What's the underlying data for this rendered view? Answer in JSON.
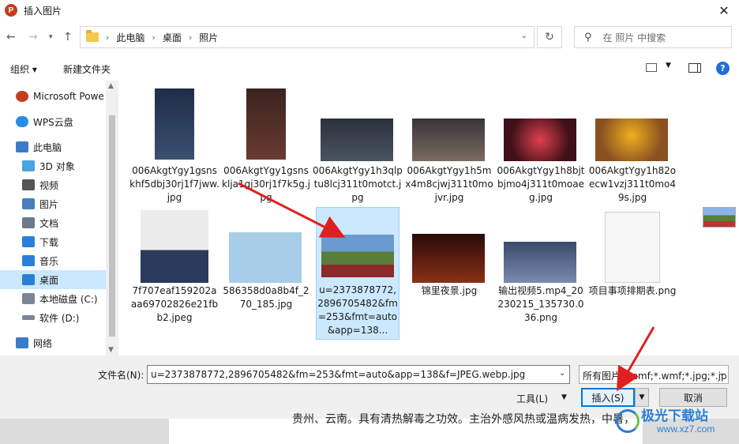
{
  "window": {
    "title": "插入图片",
    "app_icon_letter": "P"
  },
  "nav": {
    "breadcrumb": [
      "此电脑",
      "桌面",
      "照片"
    ],
    "search_placeholder": "在 照片 中搜索"
  },
  "toolbar": {
    "organize": "组织 ▾",
    "new_folder": "新建文件夹"
  },
  "sidebar": {
    "items": [
      {
        "label": "Microsoft Powe",
        "color": "#c43e1c"
      },
      {
        "label": "WPS云盘",
        "color": "#2a8be8"
      },
      {
        "label": "此电脑",
        "color": "#3a7cc9"
      },
      {
        "label": "3D 对象",
        "color": "#49a4e0"
      },
      {
        "label": "视频",
        "color": "#555"
      },
      {
        "label": "图片",
        "color": "#4a7eb8"
      },
      {
        "label": "文档",
        "color": "#6c7a8a"
      },
      {
        "label": "下载",
        "color": "#2c7fd8"
      },
      {
        "label": "音乐",
        "color": "#2c7fd8"
      },
      {
        "label": "桌面",
        "color": "#2a7fd4"
      },
      {
        "label": "本地磁盘 (C:)",
        "color": "#7a8796"
      },
      {
        "label": "软件 (D:)",
        "color": "#7a8796"
      },
      {
        "label": "网络",
        "color": "#3a7cc9"
      }
    ]
  },
  "files": [
    {
      "name": "006AkgtYgy1gsnskhf5dbj30rj1f7jww.jpg",
      "color": "#2a3b55"
    },
    {
      "name": "006AkgtYgy1gsnsklja1gj30rj1f7k5g.jpg",
      "color": "#4a2a28"
    },
    {
      "name": "006AkgtYgy1h3qlptu8lcj311t0motct.jpg",
      "color": "#3a4450"
    },
    {
      "name": "006AkgtYgy1h5mx4m8cjwj311t0mojvr.jpg",
      "color": "#5a4a48"
    },
    {
      "name": "006AkgtYgy1h8bjtbjmo4j311t0moaeg.jpg",
      "color": "#7a1a22"
    },
    {
      "name": "006AkgtYgy1h82oecw1vzj311t0mo49s.jpg",
      "color": "#c08a2a"
    },
    {
      "name": "7f707eaf159202aaa69702826e21fbb2.jpeg",
      "color": "#d8d8d8"
    },
    {
      "name": "586358d0a8b4f_270_185.jpg",
      "color": "#a8cde6"
    },
    {
      "name": "u=2373878772,2896705482&fm=253&fmt=auto&app=138...",
      "color": "#6a9ad0"
    },
    {
      "name": "锦里夜景.jpg",
      "color": "#5a2018"
    },
    {
      "name": "输出视频5.mp4_20230215_135730.036.png",
      "color": "#4a5a78"
    },
    {
      "name": "项目事项排期表.png",
      "color": "#f4f4f4"
    }
  ],
  "bottom": {
    "filename_label": "文件名(N):",
    "filename_value": "u=2373878772,2896705482&fm=253&fmt=auto&app=138&f=JPEG.webp.jpg",
    "filetype_value": "所有图片(*.emf;*.wmf;*.jpg;*.jp",
    "tools_label": "工具(L)",
    "insert_label": "插入(S)",
    "cancel_label": "取消"
  },
  "background_doc": {
    "line1": "贵州、云南。具有清热解毒之功效。主治外感风热或温病发热，中暑，"
  },
  "watermark": {
    "title": "极光下载站",
    "url": "www.xz7.com"
  }
}
